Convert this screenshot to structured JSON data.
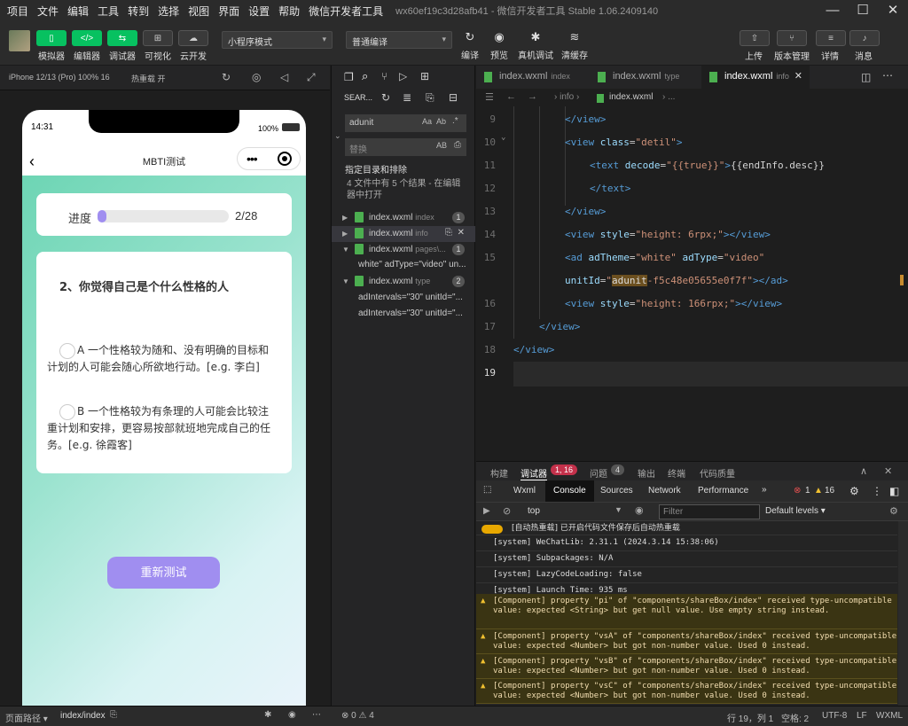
{
  "menu": [
    "项目",
    "文件",
    "编辑",
    "工具",
    "转到",
    "选择",
    "视图",
    "界面",
    "设置",
    "帮助",
    "微信开发者工具"
  ],
  "window_title": "wx60ef19c3d28afb41 - 微信开发者工具 Stable 1.06.2409140",
  "toolbar": {
    "simulator": "模拟器",
    "editor": "编辑器",
    "debugger": "调试器",
    "visual": "可视化",
    "cloud": "云开发",
    "mode": "小程序模式",
    "compile_mode": "普通编译",
    "compile": "编译",
    "preview": "预览",
    "real_debug": "真机调试",
    "clear_cache": "清缓存",
    "upload": "上传",
    "version": "版本管理",
    "details": "详情",
    "messages": "消息"
  },
  "sim_bar": {
    "device": "iPhone 12/13 (Pro) 100% 16",
    "hot_reload": "热重载 开"
  },
  "phone": {
    "time": "14:31",
    "battery": "100%",
    "title": "MBTI测试",
    "progress_label": "进度",
    "progress_text": "2/28",
    "progress_value": 0.07,
    "question": "2、你觉得自己是个什么性格的人",
    "option_a": "A 一个性格较为随和、没有明确的目标和计划的人可能会随心所欲地行动。[e.g. 李白]",
    "option_b": "B 一个性格较为有条理的人可能会比较注重计划和安排，更容易按部就班地完成自己的任务。[e.g. 徐霞客]",
    "retest": "重新测试"
  },
  "search": {
    "tab": "SEAR...",
    "query": "adunit",
    "replace_placeholder": "替换",
    "scope": "指定目录和排除",
    "summary": "4 文件中有 5 个结果 - 在编辑器中打开",
    "results": [
      {
        "file": "index.wxml",
        "dir": "index",
        "count": "1"
      },
      {
        "file": "index.wxml",
        "dir": "info",
        "count": ""
      },
      {
        "file": "index.wxml",
        "dir": "pages\\...",
        "count": "1"
      },
      {
        "file": "index.wxml",
        "dir": "type",
        "count": "2"
      }
    ],
    "matches": [
      "white\" adType=\"video\" un...",
      "adIntervals=\"30\" unitId=\"...",
      "adIntervals=\"30\" unitId=\"..."
    ]
  },
  "tabs": [
    {
      "file": "index.wxml",
      "dir": "index"
    },
    {
      "file": "index.wxml",
      "dir": "type"
    },
    {
      "file": "index.wxml",
      "dir": "info"
    }
  ],
  "breadcrumb": {
    "part1": "info",
    "part2": "index.wxml",
    "part3": "..."
  },
  "code_lines": [
    "9",
    "10",
    "11",
    "12",
    "13",
    "14",
    "15",
    "",
    "16",
    "17",
    "18",
    "19"
  ],
  "devtools": {
    "top_tabs": [
      "构建",
      "调试器",
      "问题",
      "输出",
      "终端",
      "代码质量"
    ],
    "debugger_badge": "1, 16",
    "issues_badge": "4",
    "panel_tabs": [
      "Wxml",
      "Console",
      "Sources",
      "Network",
      "Performance"
    ],
    "errors": "1",
    "warnings": "16",
    "context": "top",
    "filter_placeholder": "Filter",
    "levels": "Default levels"
  },
  "console": [
    {
      "type": "info",
      "text": "[自动热重载] 已开启代码文件保存后自动热重载"
    },
    {
      "type": "log",
      "text": "[system] WeChatLib: 2.31.1 (2024.3.14 15:38:06)"
    },
    {
      "type": "log",
      "text": "[system] Subpackages: N/A"
    },
    {
      "type": "log",
      "text": "[system] LazyCodeLoading: false"
    },
    {
      "type": "log",
      "text": "[system] Launch Time: 935 ms"
    },
    {
      "type": "warn",
      "text": "[Component] property \"pi\" of \"components/shareBox/index\" received type-uncompatible value: expected <String> but get null value. Use empty string instead."
    },
    {
      "type": "warn",
      "text": "[Component] property \"vsA\" of \"components/shareBox/index\" received type-uncompatible value: expected <Number> but got non-number value. Used 0 instead."
    },
    {
      "type": "warn",
      "text": "[Component] property \"vsB\" of \"components/shareBox/index\" received type-uncompatible value: expected <Number> but got non-number value. Used 0 instead."
    },
    {
      "type": "warn",
      "text": "[Component] property \"vsC\" of \"components/shareBox/index\" received type-uncompatible value: expected <Number> but got non-number value. Used 0 instead."
    }
  ],
  "status": {
    "page_path_label": "页面路径",
    "page_path": "index/index",
    "problems": "⊗ 0 ⚠ 4",
    "position": "行 19，列 1",
    "spaces": "空格: 2",
    "encoding": "UTF-8",
    "eol": "LF",
    "lang": "WXML"
  },
  "colors": {
    "accent": "#07c160",
    "purple": "#a08ef0"
  }
}
